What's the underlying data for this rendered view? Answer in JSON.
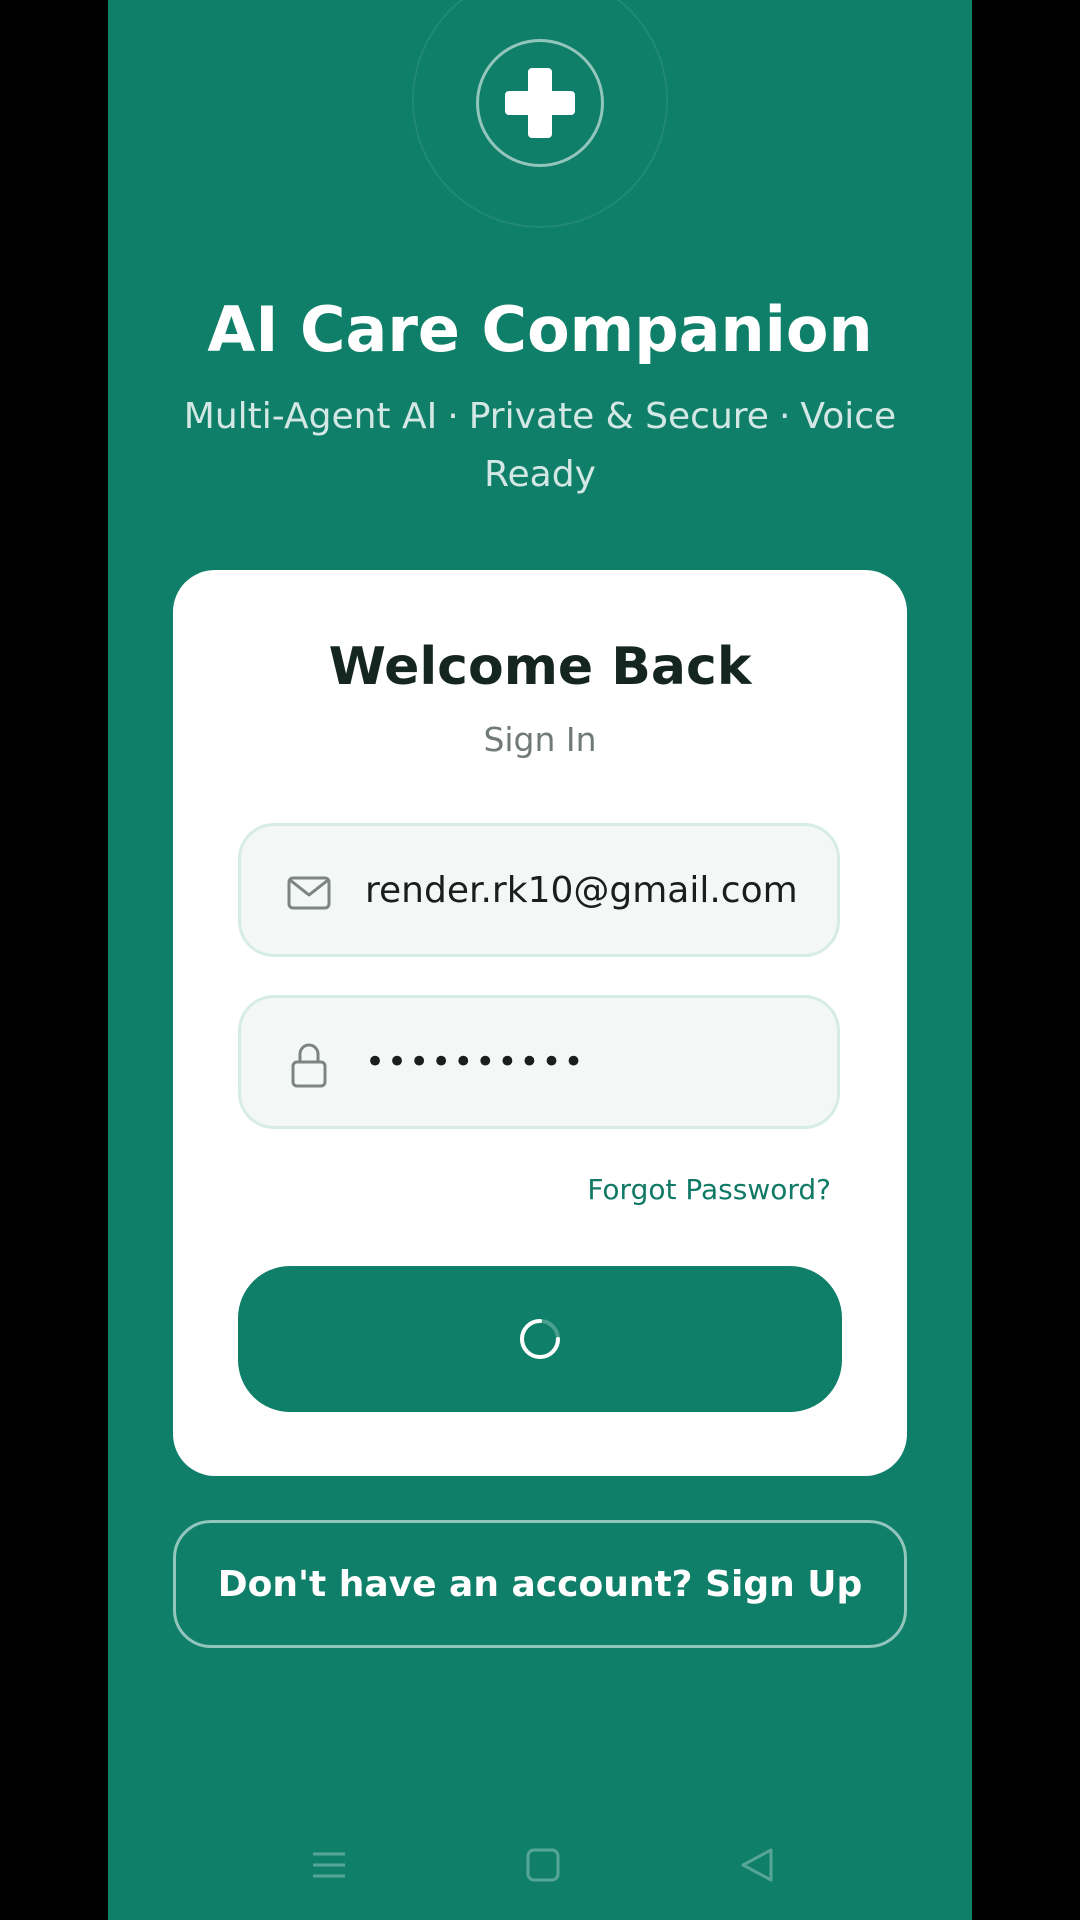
{
  "app": {
    "title": "AI Care Companion",
    "tagline": {
      "part1": "Multi-Agent AI",
      "separator": "·",
      "part2": "Private & Secure",
      "part3": "Voice Ready"
    }
  },
  "card": {
    "heading": "Welcome Back",
    "subheading": "Sign In",
    "email": {
      "value": "render.rk10@gmail.com",
      "icon": "mail-icon"
    },
    "password": {
      "value": "••••••••••",
      "icon": "lock-icon"
    },
    "forgot_password": "Forgot Password?",
    "submit_state": "loading"
  },
  "signup": {
    "label": "Don't have an account? Sign Up"
  },
  "navigation": {
    "items": [
      "menu-icon",
      "home-square-icon",
      "back-triangle-icon"
    ]
  },
  "colors": {
    "brand": "#0f7f69",
    "card": "#ffffff",
    "field_bg": "#f3f8f6",
    "field_border": "#d7ece5",
    "link": "#117a66"
  }
}
